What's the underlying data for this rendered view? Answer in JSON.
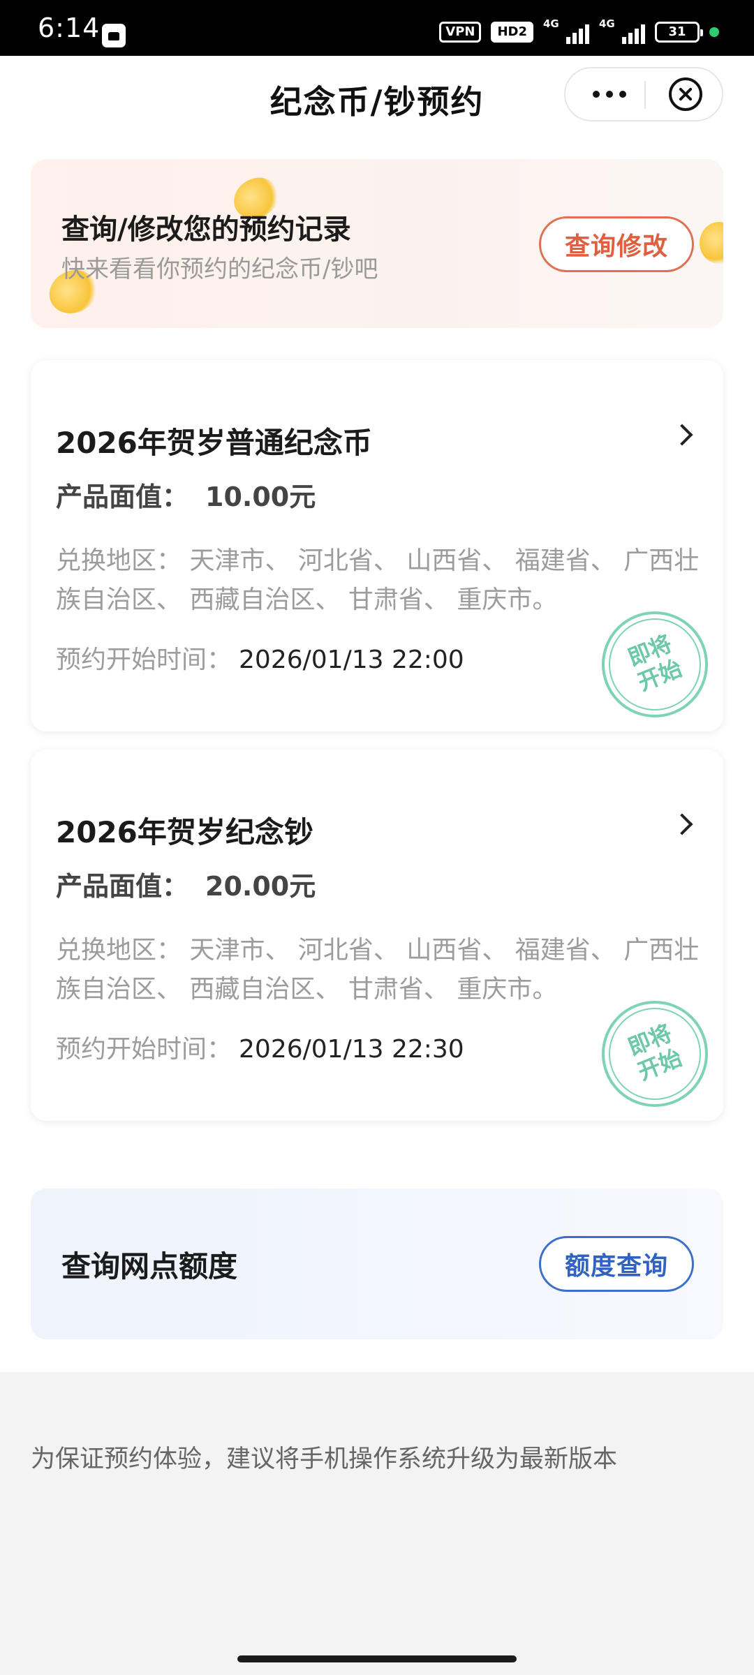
{
  "status_bar": {
    "time": "6:14",
    "vpn": "VPN",
    "hd": "HD2",
    "net1": "4G",
    "net2": "4G",
    "battery": "31"
  },
  "header": {
    "title": "纪念币/钞预约",
    "more_icon": "more-dots-icon",
    "close_icon": "close-circle-icon"
  },
  "record_banner": {
    "title": "查询/修改您的预约记录",
    "subtitle": "快来看看你预约的纪念币/钞吧",
    "button_label": "查询修改"
  },
  "products": [
    {
      "name": "2026年贺岁普通纪念币",
      "face_label": "产品面值：",
      "face_value": "10.00元",
      "region": "兑换地区：  天津市、 河北省、 山西省、 福建省、 广西壮族自治区、 西藏自治区、 甘肃省、 重庆市。",
      "time_label": "预约开始时间：",
      "time_value": "2026/01/13 22:00",
      "stamp_line1": "即将",
      "stamp_line2": "开始"
    },
    {
      "name": "2026年贺岁纪念钞",
      "face_label": "产品面值：",
      "face_value": "20.00元",
      "region": "兑换地区：  天津市、 河北省、 山西省、 福建省、 广西壮族自治区、 西藏自治区、 甘肃省、 重庆市。",
      "time_label": "预约开始时间：",
      "time_value": "2026/01/13 22:30",
      "stamp_line1": "即将",
      "stamp_line2": "开始"
    }
  ],
  "quota_banner": {
    "title": "查询网点额度",
    "button_label": "额度查询"
  },
  "footer": {
    "tip": "为保证预约体验，建议将手机操作系统升级为最新版本"
  },
  "colors": {
    "accent_orange": "#e05f3e",
    "accent_blue": "#2f62c4",
    "stamp_green": "#6cc9a6"
  }
}
